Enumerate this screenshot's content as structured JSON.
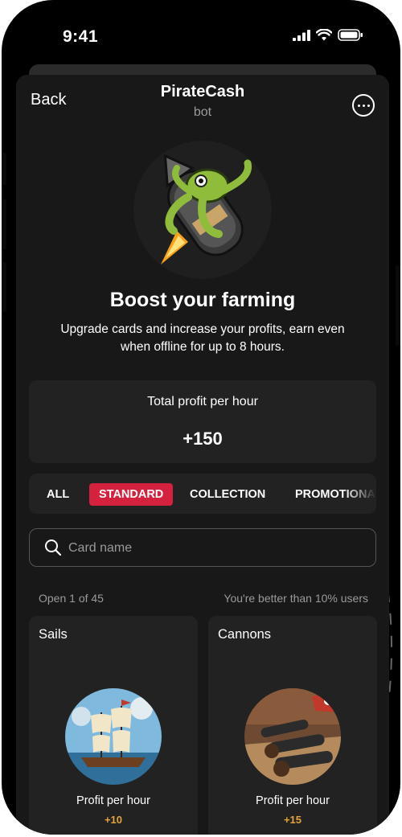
{
  "status_bar": {
    "time": "9:41"
  },
  "header": {
    "back_label": "Back",
    "title": "PirateCash",
    "subtitle": "bot"
  },
  "hero": {
    "title": "Boost your farming",
    "description": "Upgrade cards and increase your profits, earn even when offline for up to 8 hours."
  },
  "profit": {
    "label": "Total profit per hour",
    "value": "+150"
  },
  "tabs": [
    {
      "label": "ALL",
      "active": false
    },
    {
      "label": "STANDARD",
      "active": true
    },
    {
      "label": "COLLECTION",
      "active": false
    },
    {
      "label": "PROMOTIONA",
      "active": false
    }
  ],
  "search": {
    "placeholder": "Card name"
  },
  "stats": {
    "open": "Open 1 of 45",
    "rank": "You're better than 10% users"
  },
  "cards": [
    {
      "title": "Sails",
      "profit_label": "Profit per hour",
      "profit_value": "+10"
    },
    {
      "title": "Cannons",
      "profit_label": "Profit per hour",
      "profit_value": "+15"
    }
  ],
  "colors": {
    "accent": "#d4213d",
    "profit_gold": "#e3a43a",
    "background": "#181818",
    "card": "#222222"
  }
}
